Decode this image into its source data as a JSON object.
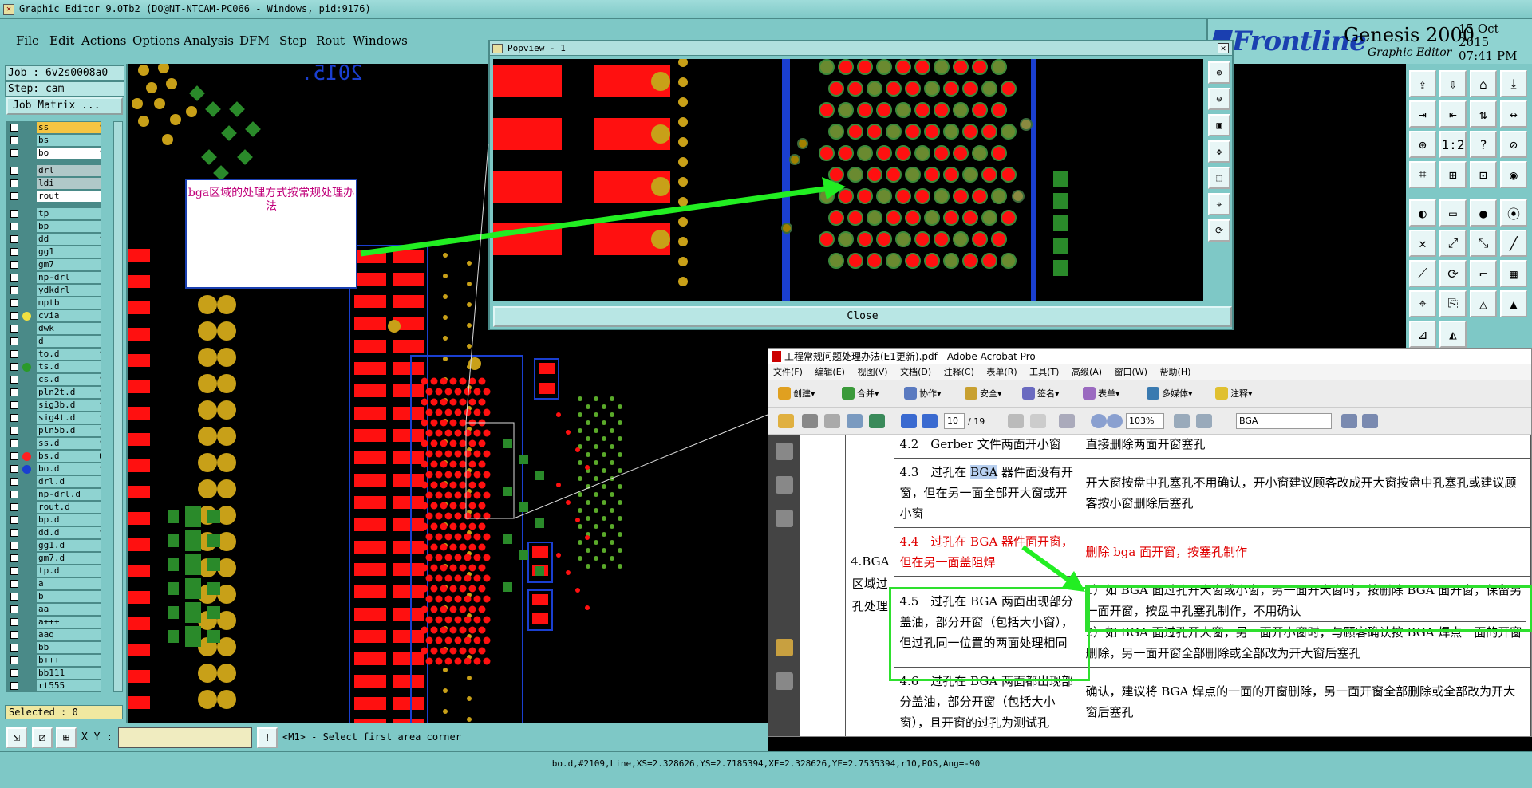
{
  "window": {
    "title": "Graphic Editor 9.0Tb2 (DO@NT-NTCAM-PC066 - Windows, pid:9176)"
  },
  "menu": [
    "File",
    "Edit",
    "Actions",
    "Options",
    "Analysis",
    "DFM",
    "Step",
    "Rout",
    "Windows"
  ],
  "logo": {
    "brand": "Frontline",
    "product": "Genesis 2000",
    "subtitle": "Graphic Editor",
    "date": "15 Oct 2015",
    "time": "07:41 PM"
  },
  "job": {
    "job": "Job : 6v2s0008a0",
    "step": "Step: cam",
    "matrix_button": "Job Matrix ..."
  },
  "layers": [
    {
      "name": "ss",
      "style": "hi",
      "icon": "✎"
    },
    {
      "name": "bs",
      "style": "",
      "icon": ""
    },
    {
      "name": "bo",
      "style": "sel",
      "icon": "✎"
    },
    {
      "gap": true
    },
    {
      "name": "drl",
      "style": "gr",
      "icon": ""
    },
    {
      "name": "ldi",
      "style": "gr",
      "icon": ""
    },
    {
      "name": "rout",
      "style": "sel",
      "icon": ""
    },
    {
      "gap": true
    },
    {
      "name": "tp",
      "style": "",
      "icon": ""
    },
    {
      "name": "bp",
      "style": "",
      "icon": ""
    },
    {
      "name": "dd",
      "style": "",
      "icon": "✎"
    },
    {
      "name": "gg1",
      "style": "",
      "icon": ""
    },
    {
      "name": "gm7",
      "style": "",
      "icon": ""
    },
    {
      "name": "np-drl",
      "style": "",
      "icon": ""
    },
    {
      "name": "ydkdrl",
      "style": "",
      "icon": ""
    },
    {
      "name": "mptb",
      "style": "",
      "icon": ""
    },
    {
      "name": "cvia",
      "style": "",
      "icon": "",
      "dot": "#f0e040"
    },
    {
      "name": "dwk",
      "style": "",
      "icon": ""
    },
    {
      "name": "d",
      "style": "",
      "icon": ""
    },
    {
      "name": "to.d",
      "style": "",
      "icon": "✎"
    },
    {
      "name": "ts.d",
      "style": "",
      "icon": "",
      "dot": "#2a9a2a"
    },
    {
      "name": "cs.d",
      "style": "",
      "icon": "✎"
    },
    {
      "name": "pln2t.d",
      "style": "",
      "icon": "✎"
    },
    {
      "name": "sig3b.d",
      "style": "",
      "icon": "✎"
    },
    {
      "name": "sig4t.d",
      "style": "",
      "icon": "✎"
    },
    {
      "name": "pln5b.d",
      "style": "",
      "icon": "✎"
    },
    {
      "name": "ss.d",
      "style": "",
      "icon": "✎"
    },
    {
      "name": "bs.d",
      "style": "",
      "icon": "■",
      "dot": "#ff2020"
    },
    {
      "name": "bo.d",
      "style": "",
      "icon": "✎",
      "dot": "#1a3fd0"
    },
    {
      "name": "drl.d",
      "style": "",
      "icon": ""
    },
    {
      "name": "np-drl.d",
      "style": "",
      "icon": ""
    },
    {
      "name": "rout.d",
      "style": "",
      "icon": ""
    },
    {
      "name": "bp.d",
      "style": "",
      "icon": ""
    },
    {
      "name": "dd.d",
      "style": "",
      "icon": "✎"
    },
    {
      "name": "gg1.d",
      "style": "",
      "icon": ""
    },
    {
      "name": "gm7.d",
      "style": "",
      "icon": ""
    },
    {
      "name": "tp.d",
      "style": "",
      "icon": ""
    },
    {
      "name": "a",
      "style": "",
      "icon": ""
    },
    {
      "name": "b",
      "style": "",
      "icon": ""
    },
    {
      "name": "aa",
      "style": "",
      "icon": ""
    },
    {
      "name": "a+++",
      "style": "",
      "icon": ""
    },
    {
      "name": "aaq",
      "style": "",
      "icon": ""
    },
    {
      "name": "bb",
      "style": "",
      "icon": ""
    },
    {
      "name": "b+++",
      "style": "",
      "icon": ""
    },
    {
      "name": "bb111",
      "style": "",
      "icon": ""
    },
    {
      "name": "rt555",
      "style": "",
      "icon": ""
    }
  ],
  "selected": "Selected : 0",
  "canvas": {
    "year_text": "2015.",
    "colors": {
      "pad_red": "#ff1010",
      "pad_gold": "#c8a018",
      "via_green": "#2a8a2a",
      "outline_blue": "#1a3fd0"
    }
  },
  "note": {
    "text": "bga区域的处理方式按常规处理办法"
  },
  "popview": {
    "title": "Popview - 1",
    "close_label": "Close"
  },
  "acrobat": {
    "title": "工程常规问题处理办法(E1更新).pdf - Adobe Acrobat Pro",
    "menu": [
      "文件(F)",
      "编辑(E)",
      "视图(V)",
      "文档(D)",
      "注释(C)",
      "表单(R)",
      "工具(T)",
      "高级(A)",
      "窗口(W)",
      "帮助(H)"
    ],
    "tools": [
      "创建",
      "合并",
      "协作",
      "安全",
      "签名",
      "表单",
      "多媒体",
      "注释"
    ],
    "page_current": "10",
    "page_total": "/ 19",
    "zoom": "103%",
    "search": "BGA",
    "category": "4.BGA区域过孔处理",
    "rows": [
      {
        "item": "4.2　Gerber 文件两面开小窗",
        "action": "直接删除两面开窗塞孔"
      },
      {
        "item_pre": "4.3　过孔在 ",
        "item_hl": "BGA",
        "item_post": " 器件面没有开窗，但在另一面全部开大窗或开小窗",
        "action": "开大窗按盘中孔塞孔不用确认，开小窗建议顾客改成开大窗按盘中孔塞孔或建议顾客按小窗删除后塞孔"
      },
      {
        "item": "4.4　过孔在 BGA 器件面开窗，但在另一面盖阻焊",
        "action": "删除 bga 面开窗，按塞孔制作",
        "red": true
      },
      {
        "item": "4.5　过孔在 BGA 两面出现部分盖油，部分开窗（包括大小窗），但过孔同一位置的两面处理相同",
        "action1": "1）如 BGA 面过孔开大窗或小窗，另一面开大窗时，按删除 BGA 面开窗，保留另一面开窗，按盘中孔塞孔制作，不用确认",
        "action2": "2）如 BGA 面过孔开大窗，另一面开小窗时，与顾客确认按 BGA 焊点一面的开窗删除，另一面开窗全部删除或全部改为开大窗后塞孔"
      },
      {
        "item": "4.6　过孔在 BGA 两面都出现部分盖油，部分开窗（包括大小窗），且开窗的过孔为测试孔",
        "action": "确认，建议将 BGA 焊点的一面的开窗删除，另一面开窗全部删除或全部改为开大窗后塞孔"
      }
    ]
  },
  "bottom": {
    "xy_label": "X Y :",
    "xy_value": "",
    "prompt": "<M1> - Select first area corner"
  },
  "status": "bo.d,#2109,Line,XS=2.328626,YS=2.7185394,XE=2.328626,YE=2.7535394,r10,POS,Ang=-90"
}
